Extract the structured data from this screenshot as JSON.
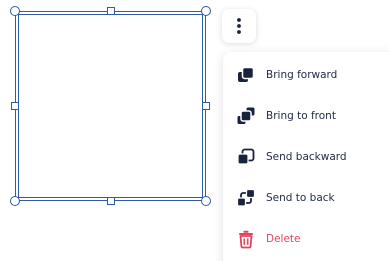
{
  "colors": {
    "selection": "#2f5aa8",
    "icon": "#18233d",
    "danger": "#e0455f"
  },
  "kebab_button": {
    "icon": "more-vertical-icon"
  },
  "context_menu": {
    "items": [
      {
        "label": "Bring forward",
        "icon": "bring-forward-icon"
      },
      {
        "label": "Bring to front",
        "icon": "bring-to-front-icon"
      },
      {
        "label": "Send backward",
        "icon": "send-backward-icon"
      },
      {
        "label": "Send to back",
        "icon": "send-to-back-icon"
      },
      {
        "label": "Delete",
        "icon": "trash-icon"
      }
    ]
  }
}
